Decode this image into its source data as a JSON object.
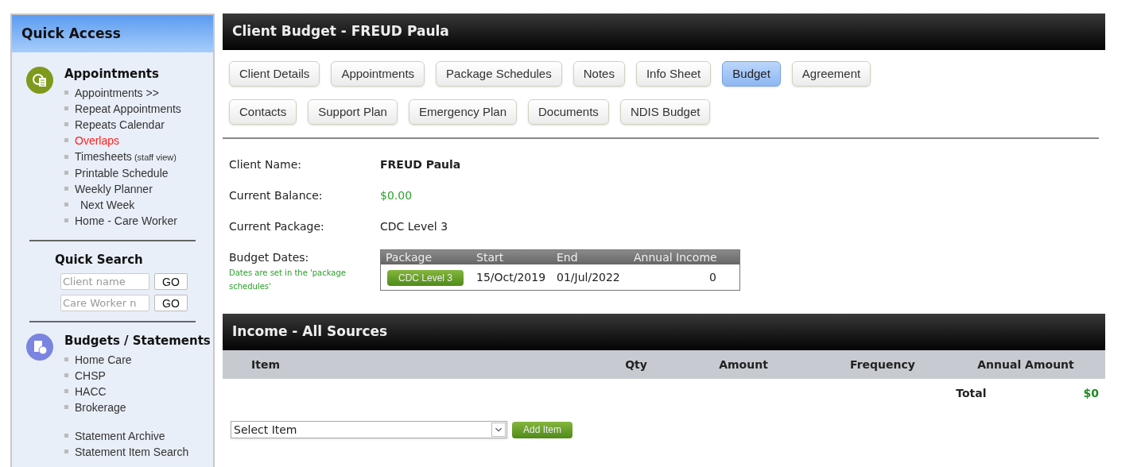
{
  "sidebar": {
    "title": "Quick Access",
    "sections": [
      {
        "kind": "links",
        "title": "Appointments",
        "groups": [
          [
            {
              "label": "Appointments >>",
              "alert": false
            },
            {
              "label": "Repeat Appointments",
              "alert": false
            },
            {
              "label": "Repeats Calendar",
              "alert": false
            },
            {
              "label": "Overlaps",
              "alert": true
            },
            {
              "label": "Timesheets",
              "note": "(staff view)",
              "alert": false
            },
            {
              "label": "Printable Schedule",
              "alert": false
            },
            {
              "label": "Weekly Planner",
              "alert": false,
              "children": [
                {
                  "label": "Next Week",
                  "alert": false
                }
              ]
            },
            {
              "label": "Home - Care Worker",
              "alert": false
            }
          ]
        ]
      },
      {
        "kind": "search",
        "title": "Quick Search",
        "fields": [
          {
            "placeholder": "Client name",
            "button": "GO"
          },
          {
            "placeholder": "Care Worker n",
            "button": "GO"
          }
        ]
      },
      {
        "kind": "links",
        "title": "Budgets / Statements",
        "groups": [
          [
            {
              "label": "Home Care",
              "alert": false
            },
            {
              "label": "CHSP",
              "alert": false
            },
            {
              "label": "HACC",
              "alert": false
            },
            {
              "label": "Brokerage",
              "alert": false
            }
          ],
          [
            {
              "label": "Statement Archive",
              "alert": false
            },
            {
              "label": "Statement Item Search",
              "alert": false
            }
          ]
        ]
      }
    ]
  },
  "page": {
    "title": "Client Budget - FREUD Paula",
    "tab_rows": [
      [
        {
          "label": "Client Details",
          "selected": false
        },
        {
          "label": "Appointments",
          "selected": false
        },
        {
          "label": "Package Schedules",
          "selected": false
        },
        {
          "label": "Notes",
          "selected": false
        },
        {
          "label": "Info Sheet",
          "selected": false
        },
        {
          "label": "Budget",
          "selected": true
        },
        {
          "label": "Agreement",
          "selected": false
        }
      ],
      [
        {
          "label": "Contacts",
          "selected": false
        },
        {
          "label": "Support Plan",
          "selected": false
        },
        {
          "label": "Emergency Plan",
          "selected": false
        },
        {
          "label": "Documents",
          "selected": false
        },
        {
          "label": "NDIS Budget",
          "selected": false
        }
      ]
    ],
    "details": [
      {
        "label": "Client Name:",
        "value": "FREUD Paula",
        "kind": "bold"
      },
      {
        "label": "Current Balance:",
        "value": "$0.00",
        "kind": "money"
      },
      {
        "label": "Current Package:",
        "value": "CDC Level 3",
        "kind": "plain"
      }
    ],
    "budget_dates": {
      "label": "Budget Dates:",
      "hint": "Dates are set in the 'package schedules'",
      "columns": [
        "Package",
        "Start",
        "End",
        "Annual Income"
      ],
      "rows": [
        {
          "package": "CDC Level 3",
          "start": "15/Oct/2019",
          "end": "01/Jul/2022",
          "annual_income": "0"
        }
      ]
    }
  },
  "income": {
    "title": "Income - All Sources",
    "columns": [
      "Item",
      "Qty",
      "Amount",
      "Frequency",
      "Annual Amount"
    ],
    "total_label": "Total",
    "total": "$0",
    "select": {
      "value": "Select Item"
    },
    "add_button": "Add Item"
  }
}
